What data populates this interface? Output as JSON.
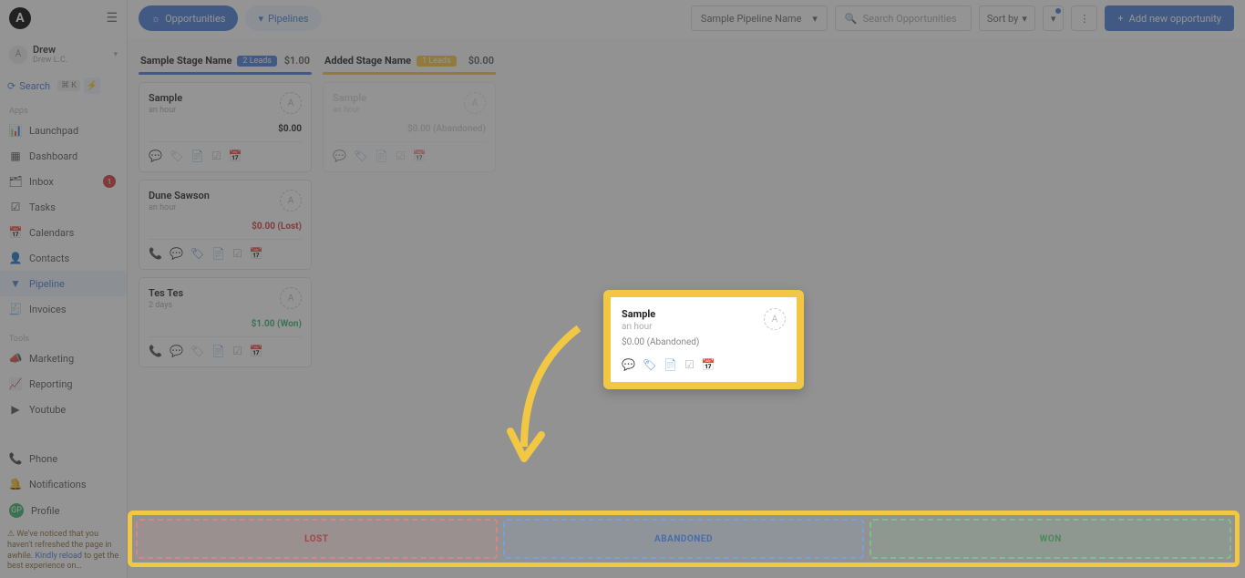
{
  "logo": "A",
  "user": {
    "name": "Drew",
    "sub": "Drew L.C."
  },
  "search": {
    "label": "Search",
    "kbd": "⌘ K"
  },
  "nav": {
    "apps_label": "Apps",
    "tools_label": "Tools",
    "items": {
      "launchpad": "Launchpad",
      "dashboard": "Dashboard",
      "inbox": "Inbox",
      "inbox_badge": "1",
      "tasks": "Tasks",
      "calendars": "Calendars",
      "contacts": "Contacts",
      "pipeline": "Pipeline",
      "invoices": "Invoices",
      "marketing": "Marketing",
      "reporting": "Reporting",
      "youtube": "Youtube",
      "phone": "Phone",
      "notifications": "Notifications",
      "profile": "Profile"
    }
  },
  "notice": {
    "pre": "⚠ We've noticed that you haven't refreshed the page in awhile. ",
    "link": "Kindly reload",
    "post": " to get the best experience on…"
  },
  "header": {
    "opportunities": "Opportunities",
    "pipelines": "Pipelines",
    "pipeline_select": "Sample Pipeline Name",
    "search_placeholder": "Search Opportunities",
    "sort_by": "Sort by",
    "add_btn": "Add new opportunity"
  },
  "columns": [
    {
      "title": "Sample Stage Name",
      "badge": "2 Leads",
      "badge_color": "blue",
      "amount": "$1.00",
      "bar": "blue",
      "cards": [
        {
          "name": "Sample",
          "time": "an hour",
          "amount": "$0.00",
          "status": ""
        },
        {
          "name": "Dune Sawson",
          "time": "an hour",
          "amount": "$0.00 (Lost)",
          "status": "lost",
          "has_dot": true
        },
        {
          "name": "Tes Tes",
          "time": "2 days",
          "amount": "$1.00 (Won)",
          "status": "won"
        }
      ]
    },
    {
      "title": "Added Stage Name",
      "badge": "1 Leads",
      "badge_color": "yellow",
      "amount": "$0.00",
      "bar": "yellow",
      "muted": true,
      "cards": [
        {
          "name": "Sample",
          "time": "an hour",
          "amount": "$0.00 (Abandoned)",
          "status": "muted"
        }
      ]
    }
  ],
  "dragged": {
    "name": "Sample",
    "time": "an hour",
    "amount": "$0.00 (Abandoned)"
  },
  "dropzones": {
    "lost": "LOST",
    "abandoned": "ABANDONED",
    "won": "WON"
  }
}
